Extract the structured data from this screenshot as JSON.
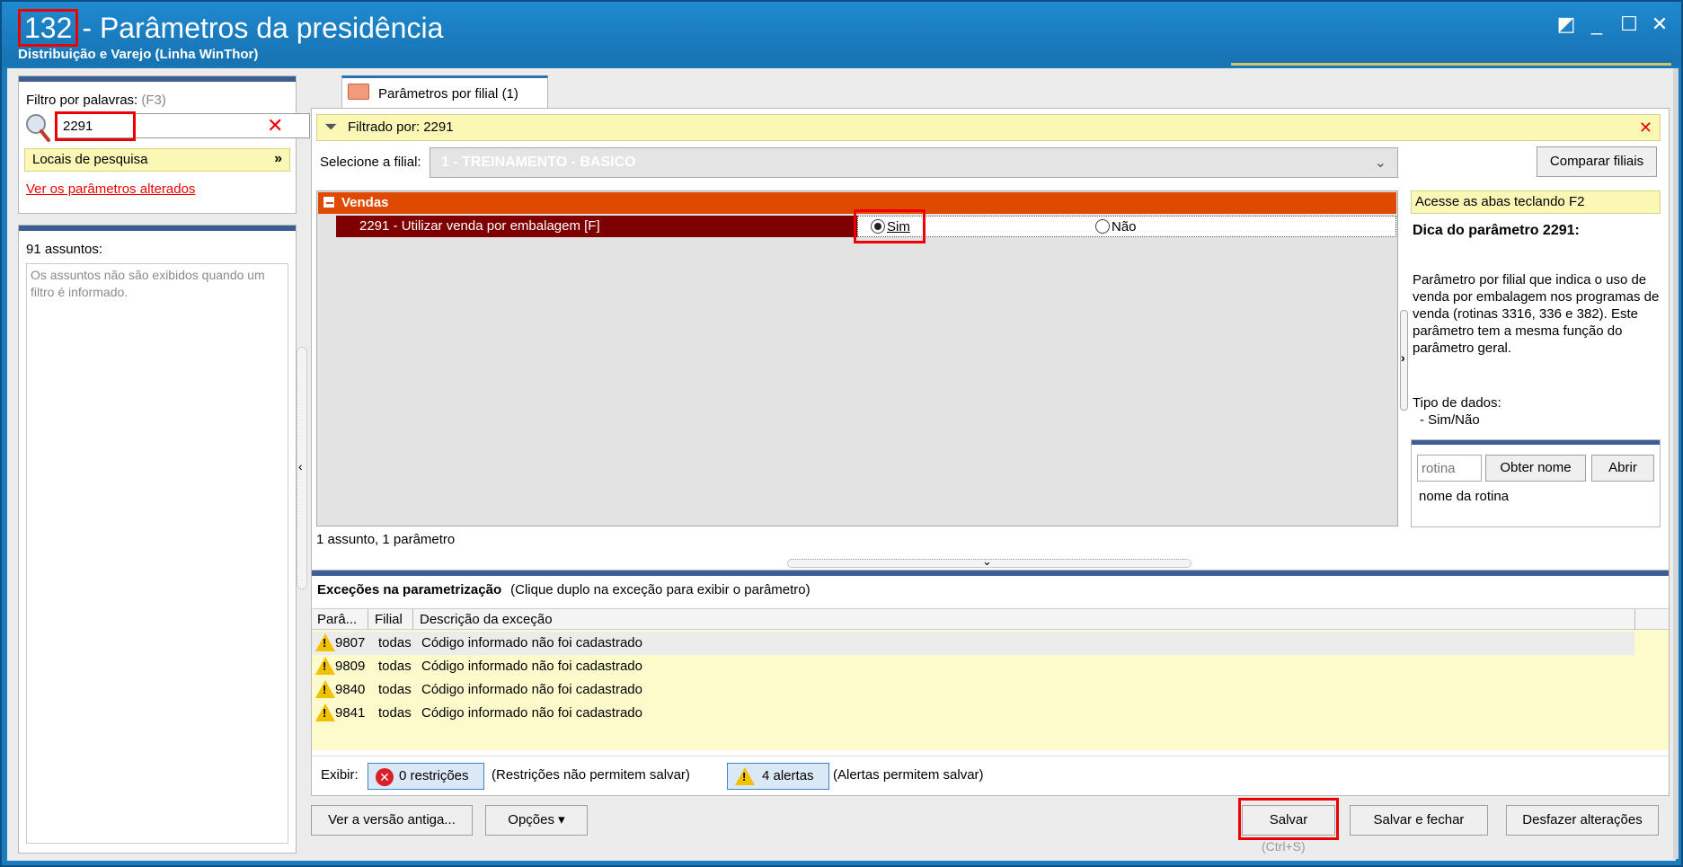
{
  "window": {
    "routine_number": "132",
    "title": "- Parâmetros da presidência",
    "subtitle": "Distribuição e Varejo (Linha WinThor)",
    "controls": [
      "restore-icon",
      "minimize-icon",
      "maximize-icon",
      "close-icon"
    ]
  },
  "filter": {
    "label": "Filtro por palavras:",
    "hint": "(F3)",
    "value": "2291",
    "locais": "Locais de pesquisa",
    "changed_link": "Ver os parâmetros alterados"
  },
  "subjects": {
    "count": "91 assuntos:",
    "note": "Os assuntos não são exibidos quando um filtro é informado."
  },
  "tab": {
    "label": "Parâmetros por filial",
    "count": "(1)"
  },
  "filterbar": {
    "text": "Filtrado por: 2291"
  },
  "filial": {
    "label": "Selecione a filial:",
    "selected": "1 - TREINAMENTO - BASICO",
    "compare_button": "Comparar filiais"
  },
  "grid": {
    "group": "Vendas",
    "param_label": "2291 - Utilizar venda por embalagem [F]",
    "options": [
      "Sim",
      "Não"
    ],
    "selected_option": "Sim",
    "status": "1 assunto, 1 parâmetro"
  },
  "help": {
    "note": "Acesse as abas teclando F2",
    "title": "Dica do parâmetro 2291:",
    "text": "Parâmetro por filial que indica o uso de venda por embalagem nos programas de venda (rotinas 3316, 336 e 382). Este parâmetro tem a mesma função do parâmetro geral.",
    "type_label": "Tipo de dados:",
    "type_value": "- Sim/Não",
    "rotina_placeholder": "rotina",
    "obter_button": "Obter nome",
    "abrir_button": "Abrir",
    "rotina_name": "nome da rotina"
  },
  "exceptions": {
    "title": "Exceções na parametrização",
    "hint": "(Clique duplo na exceção para exibir o parâmetro)",
    "columns": [
      "Parâ...",
      "Filial",
      "Descrição da exceção"
    ],
    "rows": [
      {
        "param": "9807",
        "filial": "todas",
        "desc": "Código informado não foi cadastrado"
      },
      {
        "param": "9809",
        "filial": "todas",
        "desc": "Código informado não foi cadastrado"
      },
      {
        "param": "9840",
        "filial": "todas",
        "desc": "Código informado não foi cadastrado"
      },
      {
        "param": "9841",
        "filial": "todas",
        "desc": "Código informado não foi cadastrado"
      }
    ],
    "exibir": "Exibir:",
    "restricoes_button": "0 restrições",
    "restricoes_note": "(Restrições não permitem salvar)",
    "alertas_button": "4 alertas",
    "alertas_note": "(Alertas permitem salvar)"
  },
  "footer": {
    "versao_button": "Ver a versão antiga...",
    "opcoes_button": "Opções ▾",
    "salvar_button": "Salvar",
    "salvar_shortcut": "(Ctrl+S)",
    "salvar_fechar_button": "Salvar e fechar",
    "desfazer_button": "Desfazer alterações"
  },
  "colors": {
    "titlebar": "#1a7bbd",
    "group_header": "#e04a00",
    "param_row": "#7e0000",
    "highlight": "#fbf7b4",
    "annotation_red": "#ee0000"
  }
}
